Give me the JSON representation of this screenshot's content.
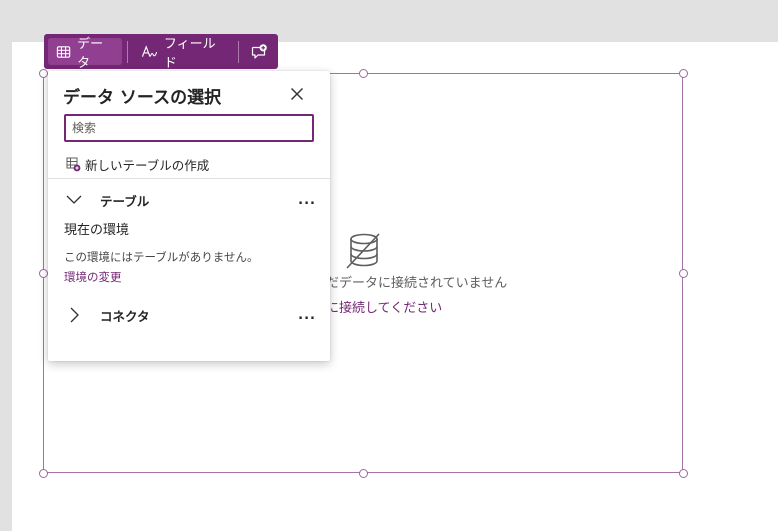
{
  "toolbar": {
    "data_label": "データ",
    "fields_label": "フィールド",
    "comment_icon": "comment-add-icon"
  },
  "placeholder": {
    "icon": "database-disconnected-icon",
    "message": "だデータに接続されていません",
    "link": "に接続してください"
  },
  "panel": {
    "title": "データ ソースの選択",
    "search_placeholder": "検索",
    "new_table_label": "新しいテーブルの作成",
    "sections": {
      "tables": {
        "label": "テーブル",
        "more": "...",
        "current_env_title": "現在の環境",
        "empty_message": "この環境にはテーブルがありません。",
        "change_env_link": "環境の変更"
      },
      "connectors": {
        "label": "コネクタ",
        "more": "..."
      }
    }
  },
  "colors": {
    "accent": "#742774",
    "selection_border": "#a571a9",
    "canvas_bg": "#ffffff",
    "workspace_bg": "#e1e1e1"
  }
}
